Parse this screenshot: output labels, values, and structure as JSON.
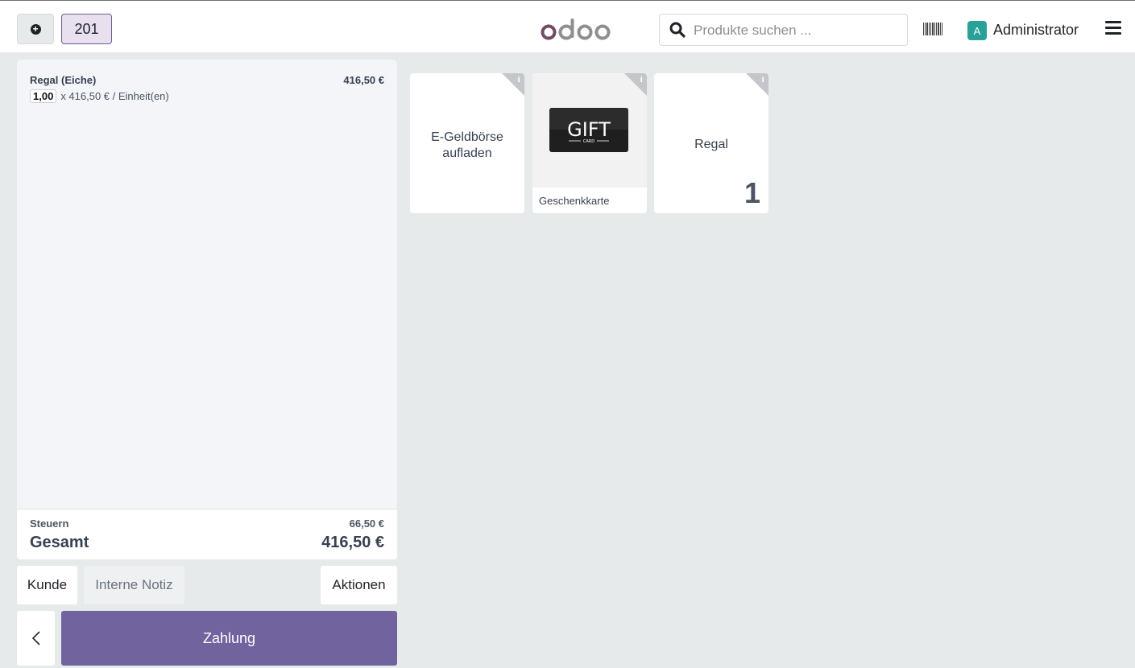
{
  "header": {
    "order_number": "201",
    "search_placeholder": "Produkte suchen ...",
    "user_initial": "A",
    "user_name": "Administrator",
    "brand_color": "#71639e",
    "accent_avatar_color": "#2aa198"
  },
  "order": {
    "lines": [
      {
        "name": "Regal (Eiche)",
        "price": "416,50 €",
        "quantity": "1,00",
        "unit_text": "x 416,50 € / Einheit(en)"
      }
    ],
    "tax_label": "Steuern",
    "tax_value": "66,50 €",
    "total_label": "Gesamt",
    "total_value": "416,50 €"
  },
  "actions": {
    "customer": "Kunde",
    "internal_note": "Interne Notiz",
    "actions": "Aktionen",
    "payment": "Zahlung"
  },
  "products": [
    {
      "name": "E-Geldbörse aufladen",
      "has_image": false,
      "icon": "info-icon"
    },
    {
      "name": "Geschenkkarte",
      "has_image": true,
      "image_text": "GIFT",
      "image_subtext": "CARD",
      "icon": "info-icon"
    },
    {
      "name": "Regal",
      "has_image": false,
      "qty": "1",
      "icon": "info-icon"
    }
  ]
}
